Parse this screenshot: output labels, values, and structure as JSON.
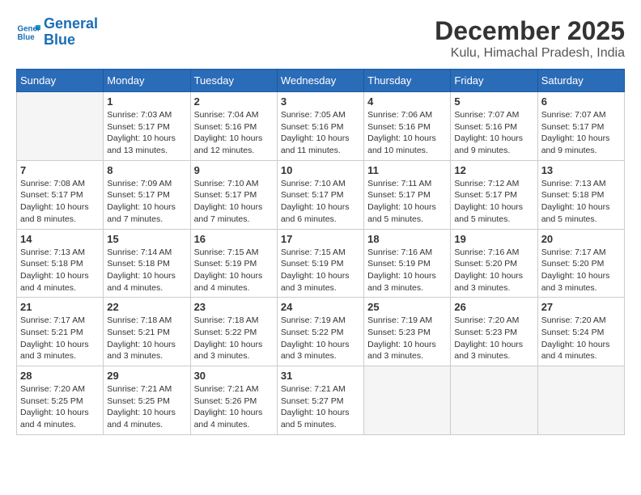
{
  "logo": {
    "line1": "General",
    "line2": "Blue"
  },
  "title": "December 2025",
  "subtitle": "Kulu, Himachal Pradesh, India",
  "days_of_week": [
    "Sunday",
    "Monday",
    "Tuesday",
    "Wednesday",
    "Thursday",
    "Friday",
    "Saturday"
  ],
  "weeks": [
    [
      {
        "day": "",
        "sunrise": "",
        "sunset": "",
        "daylight": ""
      },
      {
        "day": "1",
        "sunrise": "7:03 AM",
        "sunset": "5:17 PM",
        "daylight": "10 hours and 13 minutes."
      },
      {
        "day": "2",
        "sunrise": "7:04 AM",
        "sunset": "5:16 PM",
        "daylight": "10 hours and 12 minutes."
      },
      {
        "day": "3",
        "sunrise": "7:05 AM",
        "sunset": "5:16 PM",
        "daylight": "10 hours and 11 minutes."
      },
      {
        "day": "4",
        "sunrise": "7:06 AM",
        "sunset": "5:16 PM",
        "daylight": "10 hours and 10 minutes."
      },
      {
        "day": "5",
        "sunrise": "7:07 AM",
        "sunset": "5:16 PM",
        "daylight": "10 hours and 9 minutes."
      },
      {
        "day": "6",
        "sunrise": "7:07 AM",
        "sunset": "5:17 PM",
        "daylight": "10 hours and 9 minutes."
      }
    ],
    [
      {
        "day": "7",
        "sunrise": "7:08 AM",
        "sunset": "5:17 PM",
        "daylight": "10 hours and 8 minutes."
      },
      {
        "day": "8",
        "sunrise": "7:09 AM",
        "sunset": "5:17 PM",
        "daylight": "10 hours and 7 minutes."
      },
      {
        "day": "9",
        "sunrise": "7:10 AM",
        "sunset": "5:17 PM",
        "daylight": "10 hours and 7 minutes."
      },
      {
        "day": "10",
        "sunrise": "7:10 AM",
        "sunset": "5:17 PM",
        "daylight": "10 hours and 6 minutes."
      },
      {
        "day": "11",
        "sunrise": "7:11 AM",
        "sunset": "5:17 PM",
        "daylight": "10 hours and 5 minutes."
      },
      {
        "day": "12",
        "sunrise": "7:12 AM",
        "sunset": "5:17 PM",
        "daylight": "10 hours and 5 minutes."
      },
      {
        "day": "13",
        "sunrise": "7:13 AM",
        "sunset": "5:18 PM",
        "daylight": "10 hours and 5 minutes."
      }
    ],
    [
      {
        "day": "14",
        "sunrise": "7:13 AM",
        "sunset": "5:18 PM",
        "daylight": "10 hours and 4 minutes."
      },
      {
        "day": "15",
        "sunrise": "7:14 AM",
        "sunset": "5:18 PM",
        "daylight": "10 hours and 4 minutes."
      },
      {
        "day": "16",
        "sunrise": "7:15 AM",
        "sunset": "5:19 PM",
        "daylight": "10 hours and 4 minutes."
      },
      {
        "day": "17",
        "sunrise": "7:15 AM",
        "sunset": "5:19 PM",
        "daylight": "10 hours and 3 minutes."
      },
      {
        "day": "18",
        "sunrise": "7:16 AM",
        "sunset": "5:19 PM",
        "daylight": "10 hours and 3 minutes."
      },
      {
        "day": "19",
        "sunrise": "7:16 AM",
        "sunset": "5:20 PM",
        "daylight": "10 hours and 3 minutes."
      },
      {
        "day": "20",
        "sunrise": "7:17 AM",
        "sunset": "5:20 PM",
        "daylight": "10 hours and 3 minutes."
      }
    ],
    [
      {
        "day": "21",
        "sunrise": "7:17 AM",
        "sunset": "5:21 PM",
        "daylight": "10 hours and 3 minutes."
      },
      {
        "day": "22",
        "sunrise": "7:18 AM",
        "sunset": "5:21 PM",
        "daylight": "10 hours and 3 minutes."
      },
      {
        "day": "23",
        "sunrise": "7:18 AM",
        "sunset": "5:22 PM",
        "daylight": "10 hours and 3 minutes."
      },
      {
        "day": "24",
        "sunrise": "7:19 AM",
        "sunset": "5:22 PM",
        "daylight": "10 hours and 3 minutes."
      },
      {
        "day": "25",
        "sunrise": "7:19 AM",
        "sunset": "5:23 PM",
        "daylight": "10 hours and 3 minutes."
      },
      {
        "day": "26",
        "sunrise": "7:20 AM",
        "sunset": "5:23 PM",
        "daylight": "10 hours and 3 minutes."
      },
      {
        "day": "27",
        "sunrise": "7:20 AM",
        "sunset": "5:24 PM",
        "daylight": "10 hours and 4 minutes."
      }
    ],
    [
      {
        "day": "28",
        "sunrise": "7:20 AM",
        "sunset": "5:25 PM",
        "daylight": "10 hours and 4 minutes."
      },
      {
        "day": "29",
        "sunrise": "7:21 AM",
        "sunset": "5:25 PM",
        "daylight": "10 hours and 4 minutes."
      },
      {
        "day": "30",
        "sunrise": "7:21 AM",
        "sunset": "5:26 PM",
        "daylight": "10 hours and 4 minutes."
      },
      {
        "day": "31",
        "sunrise": "7:21 AM",
        "sunset": "5:27 PM",
        "daylight": "10 hours and 5 minutes."
      },
      {
        "day": "",
        "sunrise": "",
        "sunset": "",
        "daylight": ""
      },
      {
        "day": "",
        "sunrise": "",
        "sunset": "",
        "daylight": ""
      },
      {
        "day": "",
        "sunrise": "",
        "sunset": "",
        "daylight": ""
      }
    ]
  ],
  "labels": {
    "sunrise": "Sunrise:",
    "sunset": "Sunset:",
    "daylight": "Daylight:"
  }
}
